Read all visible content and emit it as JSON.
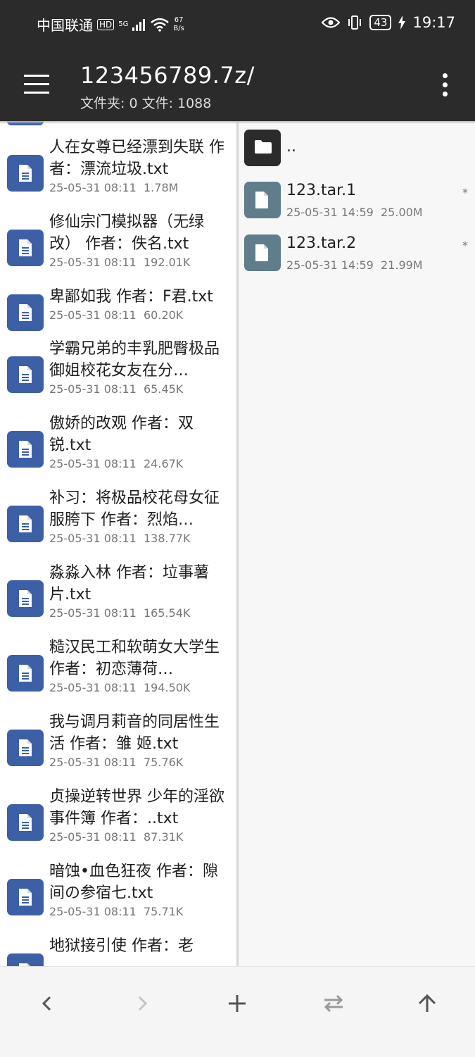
{
  "status_bar": {
    "carrier": "中国联通",
    "hd": "HD",
    "signal": "5G",
    "net_speed_value": "67",
    "net_speed_unit": "B/s",
    "battery": "43",
    "time": "19:17"
  },
  "app_bar": {
    "title": "123456789.7z/",
    "subtitle": "文件夹: 0  文件: 1088"
  },
  "left_pane": {
    "files": [
      {
        "name": "人在女尊已经漂到失联 作者：漂流垃圾.txt",
        "date": "25-05-31 08:11",
        "size": "1.78M"
      },
      {
        "name": "修仙宗门模拟器（无绿改） 作者：佚名.txt",
        "date": "25-05-31 08:11",
        "size": "192.01K"
      },
      {
        "name": "卑鄙如我 作者：F君.txt",
        "date": "25-05-31 08:11",
        "size": "60.20K"
      },
      {
        "name": "学霸兄弟的丰乳肥臀极品御姐校花女友在分…",
        "date": "25-05-31 08:11",
        "size": "65.45K"
      },
      {
        "name": "傲娇的改观 作者：双锐.txt",
        "date": "25-05-31 08:11",
        "size": "24.67K"
      },
      {
        "name": "补习：将极品校花母女征服胯下 作者：烈焰…",
        "date": "25-05-31 08:11",
        "size": "138.77K"
      },
      {
        "name": "淼淼入林 作者：垃事薯片.txt",
        "date": "25-05-31 08:11",
        "size": "165.54K"
      },
      {
        "name": "糙汉民工和软萌女大学生 作者：初恋薄荷…",
        "date": "25-05-31 08:11",
        "size": "194.50K"
      },
      {
        "name": "我与调月莉音的同居性生活 作者：雏 姬.txt",
        "date": "25-05-31 08:11",
        "size": "75.76K"
      },
      {
        "name": "贞操逆转世界 少年的淫欲事件簿 作者：..txt",
        "date": "25-05-31 08:11",
        "size": "87.31K"
      },
      {
        "name": "暗蚀•血色狂夜 作者：隙间の参宿七.txt",
        "date": "25-05-31 08:11",
        "size": "75.71K"
      },
      {
        "name": "地狱接引使 作者：老",
        "date": "",
        "size": ""
      }
    ]
  },
  "right_pane": {
    "parent": "..",
    "files": [
      {
        "name": "123.tar.1",
        "date": "25-05-31 14:59",
        "size": "25.00M",
        "mark": "*"
      },
      {
        "name": "123.tar.2",
        "date": "25-05-31 14:59",
        "size": "21.99M",
        "mark": "*"
      }
    ]
  },
  "colors": {
    "bar_bg": "#2b2b2b",
    "file_icon_left": "#3d5fa6",
    "file_icon_right": "#607d8b",
    "folder_icon": "#2b2b2b"
  },
  "icons": {
    "menu": "hamburger-icon",
    "more": "more-vertical-icon",
    "back": "chevron-left-icon",
    "forward": "chevron-right-icon",
    "add": "plus-icon",
    "swap": "swap-icon",
    "up": "arrow-up-icon"
  }
}
